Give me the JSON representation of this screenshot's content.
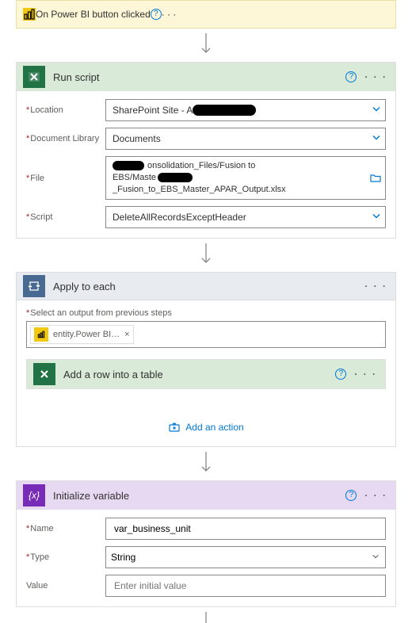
{
  "trigger": {
    "title": "On Power BI button clicked"
  },
  "run_script": {
    "title": "Run script",
    "labels": {
      "location": "Location",
      "document_library": "Document Library",
      "file": "File",
      "script": "Script"
    },
    "values": {
      "location_prefix": "SharePoint Site - A",
      "document_library": "Documents",
      "file_line1_mid": "onsolidation_Files/Fusion to",
      "file_line2_pre": "EBS/Maste",
      "file_line2_post": "_Fusion_to_EBS_Master_APAR_Output.xlsx",
      "script": "DeleteAllRecordsExceptHeader"
    }
  },
  "apply_to_each": {
    "title": "Apply to each",
    "select_label": "Select an output from previous steps",
    "token_label": "entity.Power BI…",
    "inner_action_title": "Add a row into a table",
    "add_action_label": "Add an action"
  },
  "init_var": {
    "title": "Initialize variable",
    "labels": {
      "name": "Name",
      "type": "Type",
      "value": "Value"
    },
    "values": {
      "name": "var_business_unit",
      "type": "String",
      "value_placeholder": "Enter initial value"
    }
  }
}
